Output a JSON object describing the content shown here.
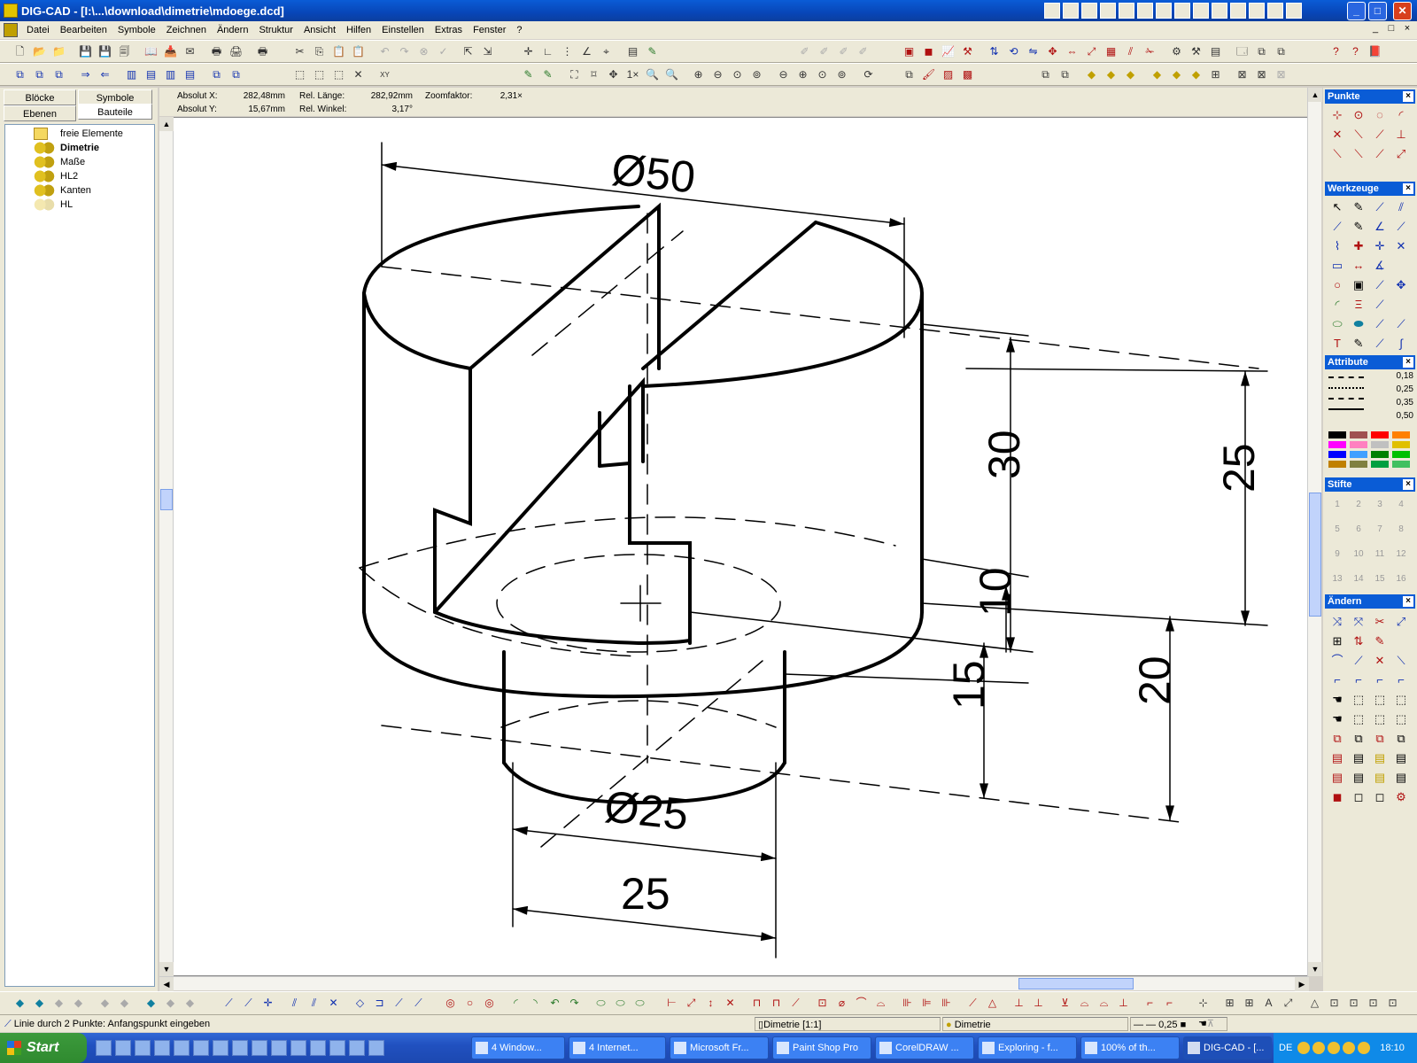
{
  "window": {
    "title": "DIG-CAD - [I:\\...\\download\\dimetrie\\mdoege.dcd]",
    "min": "_",
    "max": "□",
    "close": "✕"
  },
  "menu": {
    "items": [
      "Datei",
      "Bearbeiten",
      "Symbole",
      "Zeichnen",
      "Ändern",
      "Struktur",
      "Ansicht",
      "Hilfen",
      "Einstellen",
      "Extras",
      "Fenster",
      "?"
    ],
    "mdi_min": "_",
    "mdi_restore": "□",
    "mdi_close": "×"
  },
  "toolbar_icons": {
    "row1": [
      "new-file-icon",
      "open-icon",
      "save-icon",
      "cut-icon",
      "copy-icon",
      "paste-icon",
      "undo-icon",
      "redo-icon",
      "snap-icon",
      "grid-icon"
    ],
    "row2": [
      "zoom-icon",
      "zoom-in-icon",
      "zoom-out-icon",
      "pan-icon",
      "redraw-icon"
    ],
    "zoom_1x_label": "1×"
  },
  "left_panel": {
    "tabs": [
      "Blöcke",
      "Symbole",
      "Ebenen",
      "Bauteile"
    ],
    "tree": [
      {
        "label": "freie Elemente",
        "bold": false,
        "icon": "folder-icon"
      },
      {
        "label": "Dimetrie",
        "bold": true,
        "icon": "layer-icon"
      },
      {
        "label": "Maße",
        "bold": false,
        "icon": "layer-icon"
      },
      {
        "label": "HL2",
        "bold": false,
        "icon": "layer-icon"
      },
      {
        "label": "Kanten",
        "bold": false,
        "icon": "layer-icon"
      },
      {
        "label": "HL",
        "bold": false,
        "icon": "layer-icon-disabled"
      }
    ]
  },
  "info": {
    "absolut_x_label": "Absolut X:",
    "absolut_x_value": "282,48mm",
    "absolut_y_label": "Absolut Y:",
    "absolut_y_value": "15,67mm",
    "rel_laenge_label": "Rel. Länge:",
    "rel_laenge_value": "282,92mm",
    "rel_winkel_label": "Rel. Winkel:",
    "rel_winkel_value": "3,17°",
    "zoom_label": "Zoomfaktor:",
    "zoom_value": "2,31×"
  },
  "drawing": {
    "dim_top_diameter": "Ø50",
    "dim_bottom_diameter": "Ø25",
    "dim_bottom_width": "25",
    "dim_30": "30",
    "dim_25_right": "25",
    "dim_10": "10",
    "dim_15": "15",
    "dim_20": "20"
  },
  "right_panel": {
    "punkte": "Punkte",
    "werkzeuge": "Werkzeuge",
    "attribute": "Attribute",
    "stifte": "Stifte",
    "aendern": "Ändern",
    "close": "×",
    "line_widths": [
      "0,18",
      "0,25",
      "0,35",
      "0,50"
    ],
    "colors": [
      "#000000",
      "#a05050",
      "#ff0000",
      "#ff8000",
      "#ff00ff",
      "#ff80c0",
      "#c0c0c0",
      "#e0c000",
      "#0000ff",
      "#40a0ff",
      "#008000",
      "#00c000",
      "#c08000",
      "#808040",
      "#00a040",
      "#40c060"
    ],
    "stifte_labels": [
      "1",
      "2",
      "3",
      "4",
      "5",
      "6",
      "7",
      "8",
      "9",
      "10",
      "11",
      "12",
      "13",
      "14",
      "15",
      "16"
    ]
  },
  "status": {
    "hint": "Linie durch 2 Punkte: Anfangspunkt eingeben",
    "scale": "Dimetrie [1:1]",
    "layer": "Dimetrie",
    "line_width": "0,25"
  },
  "taskbar": {
    "start": "Start",
    "tasks": [
      "4 Window...",
      "4 Internet...",
      "Microsoft Fr...",
      "Paint Shop Pro",
      "CorelDRAW ...",
      "Exploring - f...",
      "100% of th...",
      "DIG-CAD - [..."
    ],
    "lang": "DE",
    "clock": "18:10"
  },
  "colors": {
    "titlebar": "#0a5cd6",
    "chrome": "#ece9d8",
    "taskbar": "#2151c0",
    "start": "#2f8a2f"
  }
}
